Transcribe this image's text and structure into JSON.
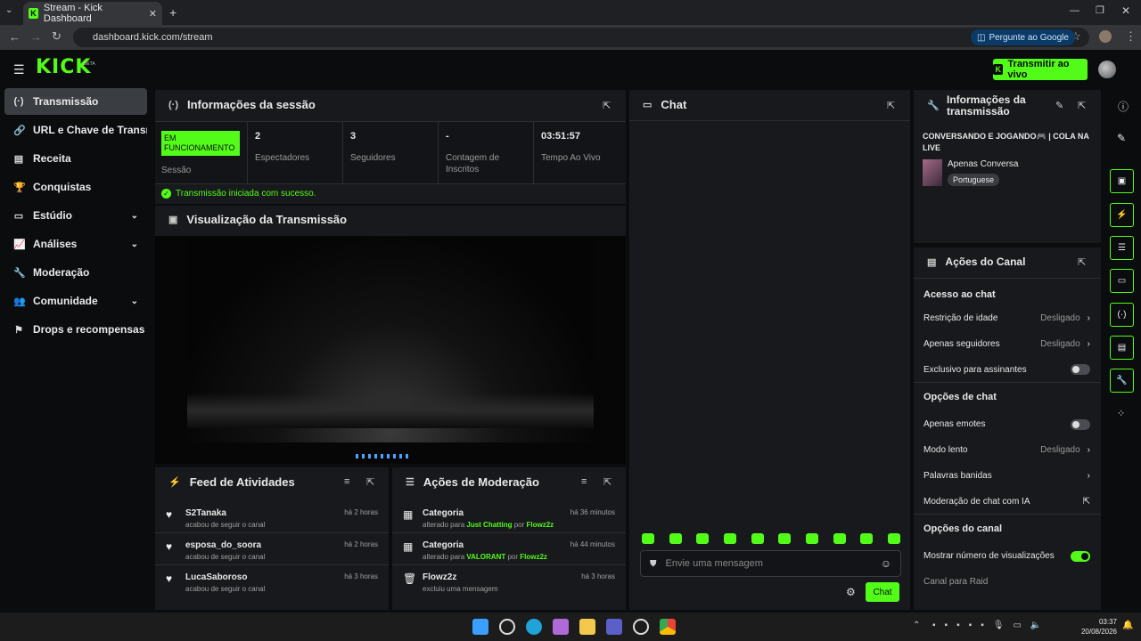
{
  "browser": {
    "tab_title": "Stream - Kick Dashboard",
    "url": "dashboard.kick.com/stream",
    "ask_google": "Pergunte ao Google"
  },
  "app": {
    "logo": "KICK",
    "beta": "BETA",
    "go_live": "Transmitir ao vivo"
  },
  "sidebar": {
    "items": [
      {
        "label": "Transmissão",
        "icon": "broadcast-icon"
      },
      {
        "label": "URL e Chave de Transmissão",
        "icon": "link-icon"
      },
      {
        "label": "Receita",
        "icon": "revenue-icon"
      },
      {
        "label": "Conquistas",
        "icon": "trophy-icon"
      },
      {
        "label": "Estúdio",
        "icon": "studio-icon"
      },
      {
        "label": "Análises",
        "icon": "analytics-icon"
      },
      {
        "label": "Moderação",
        "icon": "wrench-icon"
      },
      {
        "label": "Comunidade",
        "icon": "community-icon"
      },
      {
        "label": "Drops e recompensas",
        "icon": "drops-icon"
      }
    ]
  },
  "session": {
    "title": "Informações da sessão",
    "status": "EM FUNCIONAMENTO",
    "status_label": "Sessão",
    "viewers": "2",
    "viewers_label": "Espectadores",
    "followers": "3",
    "followers_label": "Seguidores",
    "subs": "-",
    "subs_label": "Contagem de Inscritos",
    "uptime": "03:51:57",
    "uptime_label": "Tempo Ao Vivo",
    "success": "Transmissão iniciada com sucesso."
  },
  "preview": {
    "title": "Visualização da Transmissão"
  },
  "feed": {
    "title": "Feed de Atividades",
    "rows": [
      {
        "name": "S2Tanaka",
        "sub": "acabou de seguir o canal",
        "time": "há 2 horas"
      },
      {
        "name": "esposa_do_soora",
        "sub": "acabou de seguir o canal",
        "time": "há 2 horas"
      },
      {
        "name": "LucaSaboroso",
        "sub": "acabou de seguir o canal",
        "time": "há 3 horas"
      }
    ]
  },
  "modactions": {
    "title": "Ações de Moderação",
    "rows": [
      {
        "name": "Categoria",
        "pre": "alterado para ",
        "hl1": "Just Chatting",
        "mid": " por ",
        "hl2": "Flowz2z",
        "time": "há 36 minutos"
      },
      {
        "name": "Categoria",
        "pre": "alterado para ",
        "hl1": "VALORANT",
        "mid": " por ",
        "hl2": "Flowz2z",
        "time": "há 44 minutos"
      },
      {
        "name": "Flowz2z",
        "pre": "excluiu uma mensagem",
        "hl1": "",
        "mid": "",
        "hl2": "",
        "time": "há 3 horas"
      }
    ]
  },
  "chat": {
    "title": "Chat",
    "placeholder": "Envie uma mensagem",
    "send": "Chat"
  },
  "streaminfo": {
    "title": "Informações da transmissão",
    "stream_title": "CONVERSANDO E JOGANDO🎮 | COLA NA LIVE",
    "category": "Apenas Conversa",
    "language": "Portuguese"
  },
  "channel": {
    "title": "Ações do Canal",
    "chat_access": "Acesso ao chat",
    "age": "Restrição de idade",
    "age_val": "Desligado",
    "followers_only": "Apenas seguidores",
    "followers_val": "Desligado",
    "subs_only": "Exclusivo para assinantes",
    "chat_options": "Opções de chat",
    "emotes_only": "Apenas emotes",
    "slow": "Modo lento",
    "slow_val": "Desligado",
    "banned": "Palavras banidas",
    "ai_mod": "Moderação de chat com IA",
    "channel_options": "Opções do canal",
    "show_views": "Mostrar número de visualizações",
    "raid": "Canal para Raid"
  },
  "taskbar": {
    "time": "03:37",
    "date": "20/08/2026"
  },
  "colors": {
    "accent": "#53fc18",
    "panel": "#18191c",
    "bg": "#0b0c0e"
  }
}
